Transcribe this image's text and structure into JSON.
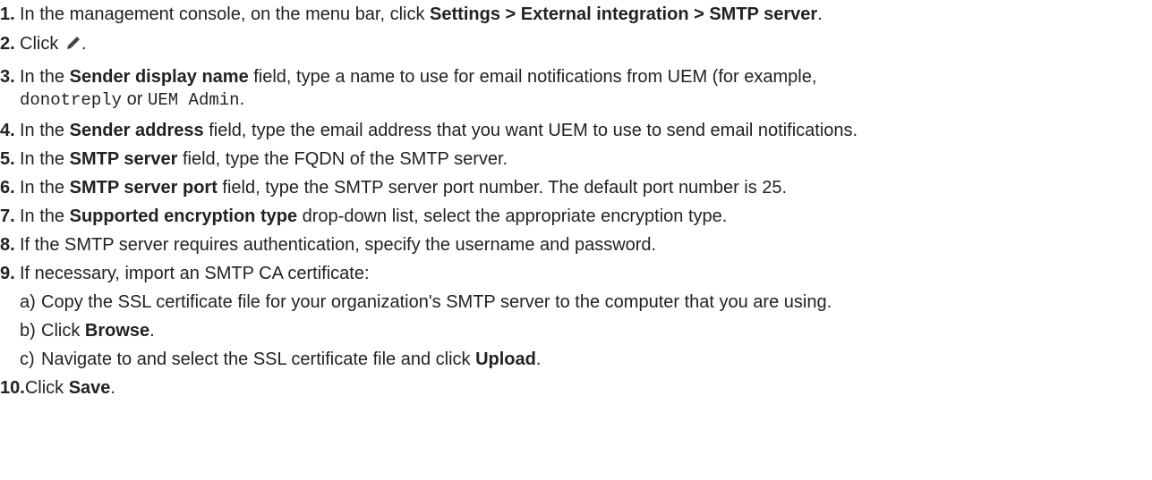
{
  "steps": [
    {
      "num": "1.",
      "pre": "In the management console, on the menu bar, click ",
      "bold": "Settings > External integration > SMTP server",
      "post": "."
    },
    {
      "num": "2.",
      "pre": "Click ",
      "icon": "pencil-edit-icon",
      "post": "."
    },
    {
      "num": "3.",
      "pre": "In the ",
      "bold": "Sender display name",
      "post": " field, type a name to use for email notifications from UEM (for example,",
      "cont_code1": "donotreply",
      "cont_or": " or ",
      "cont_code2": "UEM Admin",
      "cont_post": "."
    },
    {
      "num": "4.",
      "pre": "In the ",
      "bold": "Sender address",
      "post": " field, type the email address that you want UEM to use to send email notifications."
    },
    {
      "num": "5.",
      "pre": "In the ",
      "bold": "SMTP server",
      "post": " field, type the FQDN of the SMTP server."
    },
    {
      "num": "6.",
      "pre": "In the ",
      "bold": "SMTP server port",
      "post": " field, type the SMTP server port number. The default port number is 25."
    },
    {
      "num": "7.",
      "pre": "In the ",
      "bold": "Supported encryption type",
      "post": " drop-down list, select the appropriate encryption type."
    },
    {
      "num": "8.",
      "pre": "If the SMTP server requires authentication, specify the username and password."
    },
    {
      "num": "9.",
      "pre": "If necessary, import an SMTP CA certificate:",
      "sub": [
        {
          "letter": "a)",
          "pre": "Copy the SSL certificate file for your organization's SMTP server to the computer that you are using."
        },
        {
          "letter": "b)",
          "pre": "Click ",
          "bold": "Browse",
          "post": "."
        },
        {
          "letter": "c)",
          "pre": "Navigate to and select the SSL certificate file and click ",
          "bold": "Upload",
          "post": "."
        }
      ]
    },
    {
      "num": "10.",
      "pre": "Click ",
      "bold": "Save",
      "post": "."
    }
  ]
}
